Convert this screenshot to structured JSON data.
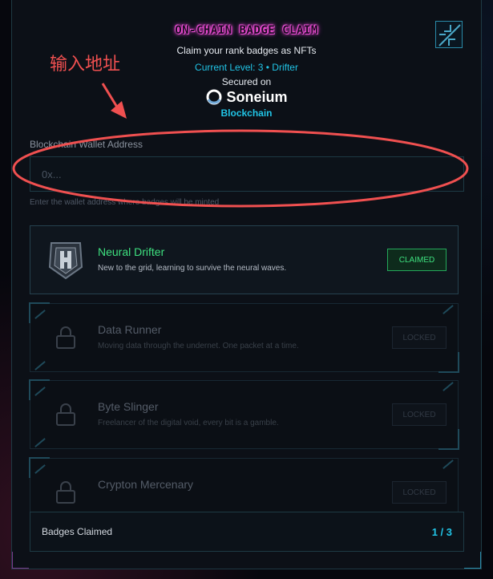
{
  "modal": {
    "title": "ON-CHAIN BADGE CLAIM",
    "subtitle": "Claim your rank badges as NFTs",
    "level_text": "Current Level: 3 • Drifter",
    "secured_label": "Secured on",
    "brand_name": "Soneium",
    "chain_label": "Blockchain",
    "close_icon": "close-icon"
  },
  "wallet": {
    "label": "Blockchain Wallet Address",
    "placeholder": "0x...",
    "value": "",
    "hint": "Enter the wallet address where badges will be minted"
  },
  "badges": [
    {
      "name": "Neural Drifter",
      "description": "New to the grid, learning to survive the neural waves.",
      "status": "CLAIMED",
      "icon": "shield-badge-icon"
    },
    {
      "name": "Data Runner",
      "description": "Moving data through the undernet. One packet at a time.",
      "status": "LOCKED",
      "icon": "lock-icon"
    },
    {
      "name": "Byte Slinger",
      "description": "Freelancer of the digital void, every bit is a gamble.",
      "status": "LOCKED",
      "icon": "lock-icon"
    },
    {
      "name": "Crypton Mercenary",
      "description": "",
      "status": "LOCKED",
      "icon": "lock-icon"
    }
  ],
  "footer": {
    "label": "Badges Claimed",
    "count": "1 / 3"
  },
  "annotation": {
    "text": "输入地址"
  },
  "colors": {
    "accent_cyan": "#21c4e6",
    "claimed_green": "#3ee07f",
    "title_magenta": "#ff4fd8",
    "annotation_red": "#f05050"
  }
}
